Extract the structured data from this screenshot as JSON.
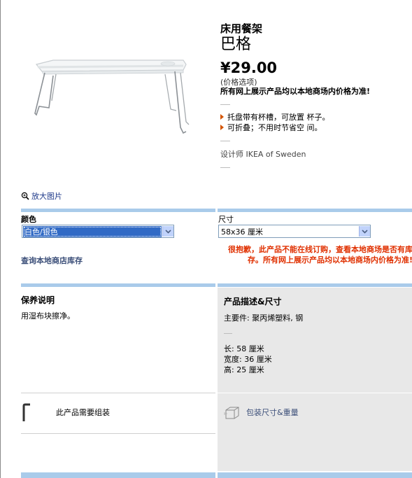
{
  "product": {
    "type": "床用餐架",
    "name": "巴格",
    "price": "¥29.00",
    "price_note": "(价格选项)",
    "price_warning": "所有网上展示产品均以本地商场内价格为准!",
    "features": [
      "托盘带有杯槽，可放置 杯子。",
      "可折叠；不用时节省空 间。"
    ],
    "designer": "设计师 IKEA of Sweden"
  },
  "zoom_link": "放大图片",
  "options": {
    "color_label": "颜色",
    "color_value": "白色/银色",
    "size_label": "尺寸",
    "size_value": "58x36 厘米"
  },
  "store_stock_link": "查询本地商店库存",
  "online_warning": "很抱歉，此产品不能在线订购，查看本地商场是否有库存。所有网上展示产品均以本地商场内价格为准!",
  "care": {
    "title": "保养说明",
    "text": "用湿布块擦净。"
  },
  "description": {
    "title": "产品描述&尺寸",
    "material": "主要件: 聚丙烯塑料, 钢",
    "length": "长: 58 厘米",
    "width": "宽度: 36 厘米",
    "height": "高: 25 厘米"
  },
  "assembly_text": "此产品需要组装",
  "package_link": "包装尺寸&重量",
  "colors": {
    "accent_bar": "#a9cbea",
    "error": "#e03000",
    "link": "#3c4f79"
  }
}
